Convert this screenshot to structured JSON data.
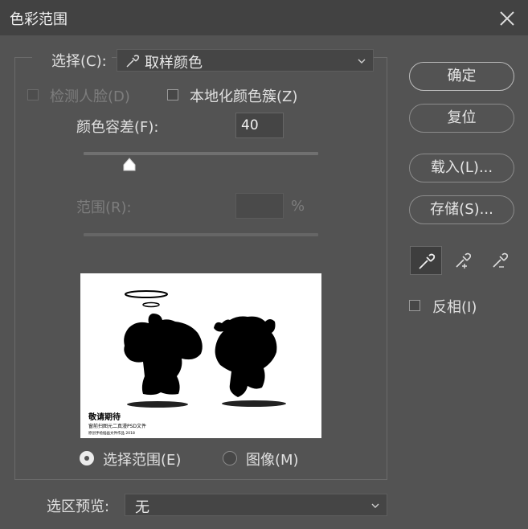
{
  "dialog": {
    "title": "色彩范围"
  },
  "select_row": {
    "label": "选择(C):",
    "value": "取样颜色"
  },
  "options": {
    "detect_faces": {
      "label": "检测人脸(D)",
      "checked": false,
      "enabled": false
    },
    "localized_clusters": {
      "label": "本地化颜色簇(Z)",
      "checked": false
    }
  },
  "fuzziness": {
    "label": "颜色容差(F):",
    "value": "40",
    "slider_fraction": 0.2
  },
  "range": {
    "label": "范围(R):",
    "value": "",
    "unit": "%"
  },
  "view_mode": {
    "selection_label": "选择范围(E)",
    "image_label": "图像(M)",
    "selected": "selection"
  },
  "preview_text": {
    "line1": "敬请期待",
    "line2": "窗前扫图元二真漫PSD文件",
    "line3": "原创手绘插画文件作品 2018"
  },
  "selection_preview": {
    "label": "选区预览:",
    "value": "无"
  },
  "buttons": {
    "ok": "确定",
    "reset": "复位",
    "load": "载入(L)...",
    "save": "存储(S)..."
  },
  "tools": [
    "eyedropper-icon",
    "eyedropper-plus-icon",
    "eyedropper-minus-icon"
  ],
  "invert": {
    "label": "反相(I)",
    "checked": false
  },
  "colors": {
    "dialog_bg": "#535353",
    "title_bar": "#424242",
    "text": "#e6e6e6",
    "disabled_text": "#7d7d7d"
  }
}
